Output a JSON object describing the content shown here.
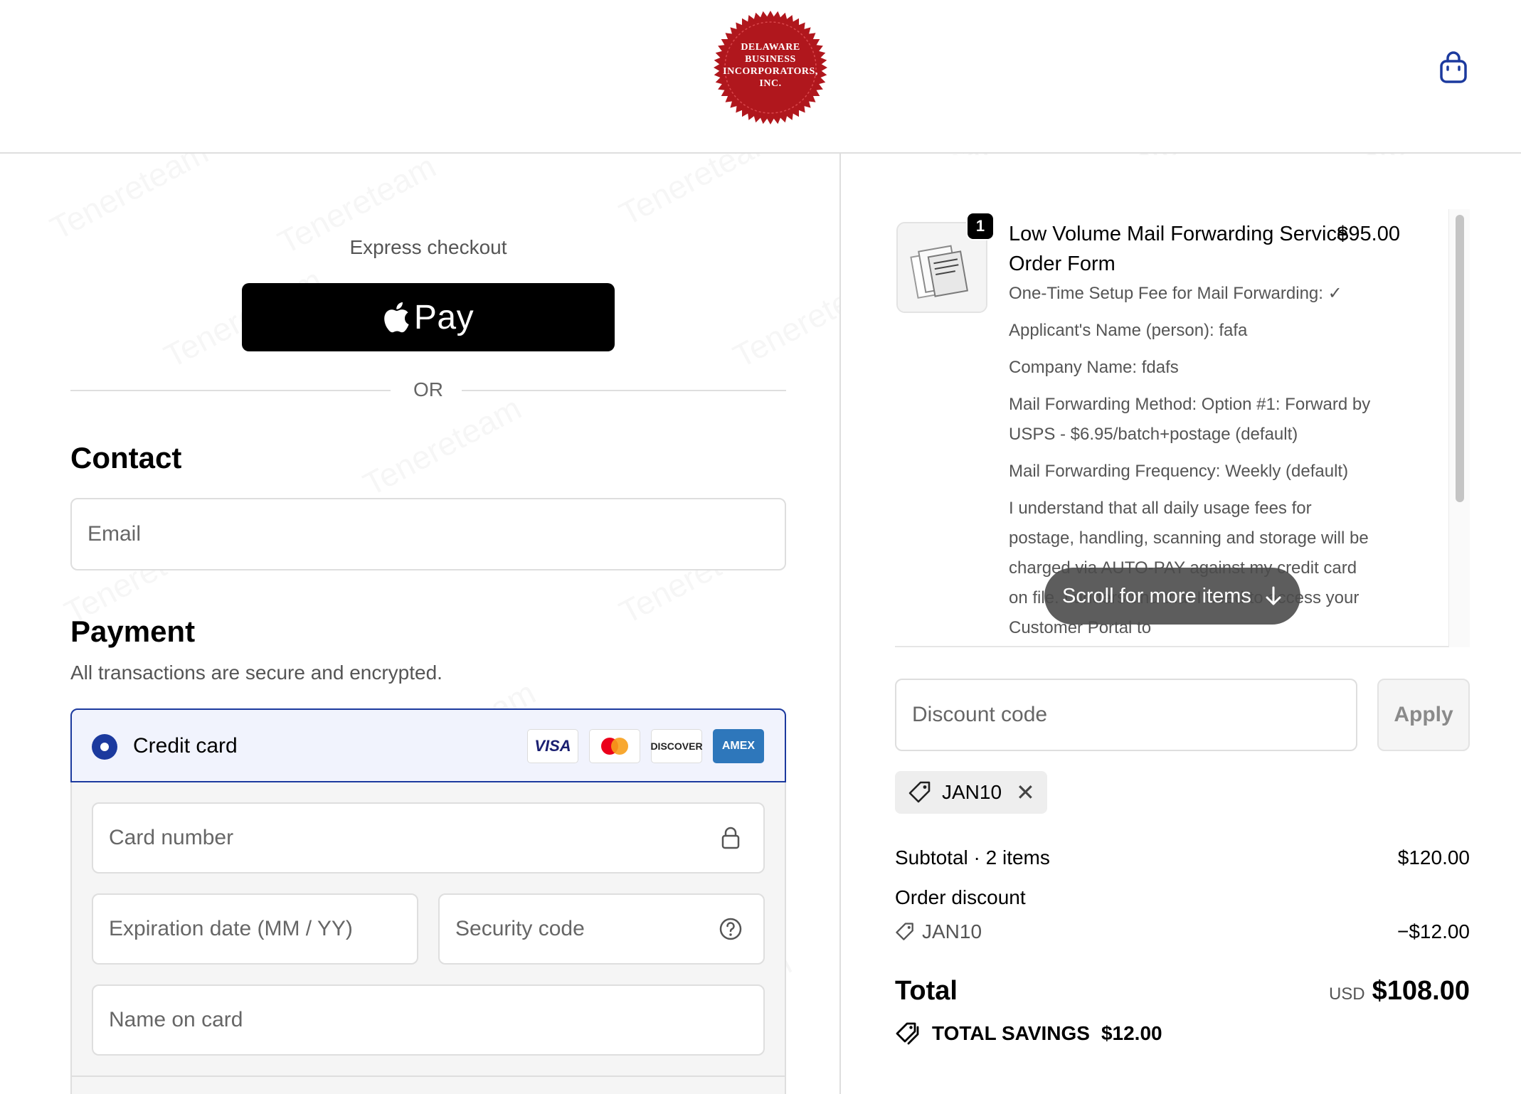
{
  "header": {
    "logo_lines": [
      "DELAWARE",
      "BUSINESS",
      "INCORPORATORS,",
      "INC."
    ],
    "cart_icon": "shopping-bag-icon",
    "brand_red": "#b0171d",
    "accent": "#1c3a9e"
  },
  "express": {
    "label": "Express checkout",
    "apple_pay_label": "Pay",
    "apple_icon": "apple-icon",
    "or_label": "OR"
  },
  "contact": {
    "heading": "Contact",
    "email_placeholder": "Email"
  },
  "payment": {
    "heading": "Payment",
    "subtitle": "All transactions are secure and encrypted.",
    "method_label": "Credit card",
    "brands": [
      "VISA",
      "MASTERCARD",
      "DISCOVER",
      "AMEX"
    ],
    "card_number_placeholder": "Card number",
    "expiration_placeholder": "Expiration date (MM / YY)",
    "security_code_placeholder": "Security code",
    "name_on_card_placeholder": "Name on card"
  },
  "order": {
    "item": {
      "quantity": "1",
      "name": "Low Volume Mail Forwarding Service Order Form",
      "price": "$95.00",
      "properties": [
        "One-Time Setup Fee for Mail Forwarding: ✓",
        "Applicant's Name (person): fafa",
        "Company Name: fdafs",
        "Mail Forwarding Method: Option #1: Forward by USPS - $6.95/batch+postage (default)",
        "Mail Forwarding Frequency: Weekly (default)",
        "I understand that all daily usage fees for postage, handling, scanning and storage will be charged via AUTO-PAY against my credit card on file. I understand that I need to access your Customer Portal to"
      ]
    },
    "scroll_hint": "Scroll for more items",
    "discount_placeholder": "Discount code",
    "apply_label": "Apply",
    "applied_code": "JAN10",
    "subtotal_label": "Subtotal · 2 items",
    "subtotal_value": "$120.00",
    "order_discount_label": "Order discount",
    "discount_code_label": "JAN10",
    "discount_value": "−$12.00",
    "total_label": "Total",
    "currency": "USD",
    "total_value": "$108.00",
    "savings_label": "TOTAL SAVINGS",
    "savings_value": "$12.00"
  }
}
